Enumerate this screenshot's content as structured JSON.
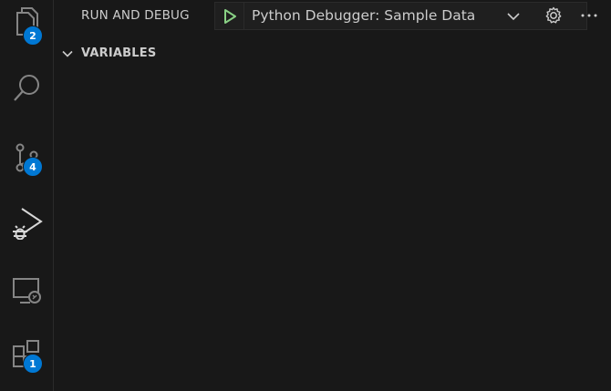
{
  "activity_bar": {
    "explorer_badge": "2",
    "source_control_badge": "4",
    "extensions_badge": "1"
  },
  "header": {
    "title": "RUN AND DEBUG",
    "launch_config": "Python Debugger: Sample Data"
  },
  "variables_section": {
    "label": "VARIABLES"
  },
  "colors": {
    "background": "#181818",
    "badge": "#0078d4",
    "play_green": "#89d185",
    "text": "#cccccc",
    "icon": "#858585"
  },
  "icons": [
    "explorer-icon",
    "search-icon",
    "source-control-icon",
    "run-debug-icon",
    "remote-explorer-icon",
    "extensions-icon",
    "play-icon",
    "chevron-down-icon",
    "gear-icon",
    "more-icon"
  ]
}
